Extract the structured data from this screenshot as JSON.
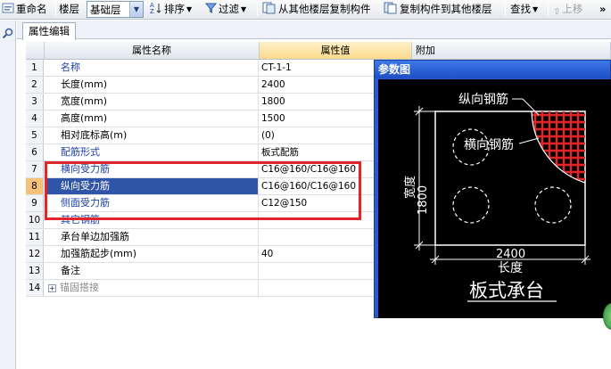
{
  "toolbar": {
    "rename": "重命名",
    "floor_label": "楼层",
    "floor_value": "基础层",
    "sort": "排序",
    "filter": "过滤",
    "copy_from": "从其他楼层复制构件",
    "copy_to": "复制构件到其他楼层",
    "find": "查找",
    "move_up": "上移",
    "more": "»"
  },
  "tab": {
    "label": "属性编辑"
  },
  "grid": {
    "headers": {
      "name": "属性名称",
      "value": "属性值",
      "add": "附加"
    },
    "rows": [
      {
        "no": "1",
        "name": "名称",
        "value": "CT-1-1",
        "style": "blue"
      },
      {
        "no": "2",
        "name": "长度(mm)",
        "value": "2400",
        "style": "normal"
      },
      {
        "no": "3",
        "name": "宽度(mm)",
        "value": "1800",
        "style": "normal"
      },
      {
        "no": "4",
        "name": "高度(mm)",
        "value": "1500",
        "style": "normal"
      },
      {
        "no": "5",
        "name": "相对底标高(m)",
        "value": "(0)",
        "style": "normal"
      },
      {
        "no": "6",
        "name": "配筋形式",
        "value": "板式配筋",
        "style": "blue"
      },
      {
        "no": "7",
        "name": "横向受力筋",
        "value": "C16@160/C16@160",
        "style": "blue"
      },
      {
        "no": "8",
        "name": "纵向受力筋",
        "value": "C16@160/C16@160",
        "style": "selected"
      },
      {
        "no": "9",
        "name": "侧面受力筋",
        "value": "C12@150",
        "style": "blue"
      },
      {
        "no": "10",
        "name": "其它钢筋",
        "value": "",
        "style": "blue"
      },
      {
        "no": "11",
        "name": "承台单边加强筋",
        "value": "",
        "style": "normal"
      },
      {
        "no": "12",
        "name": "加强筋起步(mm)",
        "value": "40",
        "style": "normal"
      },
      {
        "no": "13",
        "name": "备注",
        "value": "",
        "style": "normal"
      },
      {
        "no": "14",
        "name": "锚固搭接",
        "value": "",
        "style": "gray"
      }
    ]
  },
  "param_window": {
    "title": "参数图",
    "labels": {
      "longitudinal": "纵向钢筋",
      "transverse": "横向钢筋",
      "width_word": "宽度",
      "width_value": "1800",
      "length_value": "2400",
      "length_word": "长度",
      "caption": "板式承台"
    }
  },
  "colors": {
    "highlight": "#e0262a",
    "selection": "#2f55a8",
    "mesh": "#e0262a"
  }
}
